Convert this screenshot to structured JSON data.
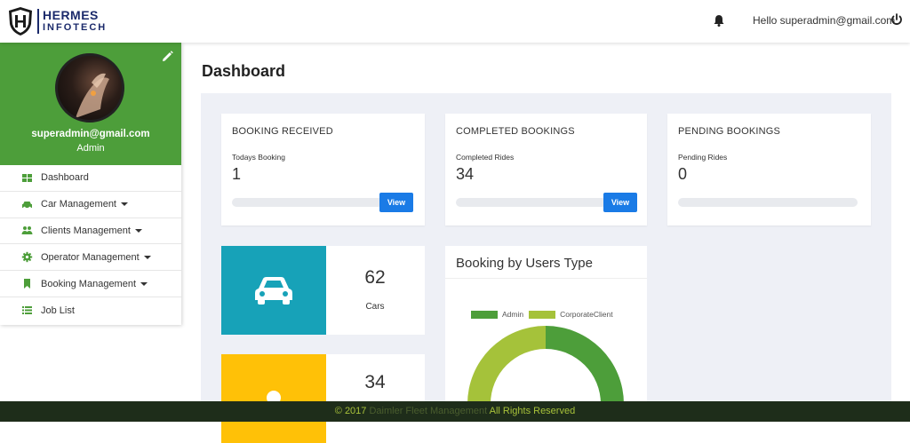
{
  "brand": {
    "line1": "HERMES",
    "line2": "INFOTECH",
    "color": "#1b2a6b"
  },
  "header": {
    "greeting": "Hello superadmin@gmail.com",
    "bell_icon": "bell-icon",
    "logout_icon": "power-icon"
  },
  "profile": {
    "email": "superadmin@gmail.com",
    "role": "Admin",
    "bg_color": "#4d9e3a"
  },
  "sidebar": {
    "items": [
      {
        "label": "Dashboard",
        "icon": "dashboard-icon",
        "has_caret": false
      },
      {
        "label": "Car Management",
        "icon": "car-icon",
        "has_caret": true
      },
      {
        "label": "Clients Management",
        "icon": "users-icon",
        "has_caret": true
      },
      {
        "label": "Operator Management",
        "icon": "gear-icon",
        "has_caret": true
      },
      {
        "label": "Booking Management",
        "icon": "bookmark-icon",
        "has_caret": true
      },
      {
        "label": "Job List",
        "icon": "list-icon",
        "has_caret": false
      }
    ]
  },
  "page": {
    "title": "Dashboard"
  },
  "cards": [
    {
      "heading": "BOOKING RECEIVED",
      "sub": "Todays Booking",
      "value": "1",
      "button": "View"
    },
    {
      "heading": "COMPLETED BOOKINGS",
      "sub": "Completed Rides",
      "value": "34",
      "button": "View"
    },
    {
      "heading": "PENDING BOOKINGS",
      "sub": "Pending Rides",
      "value": "0"
    }
  ],
  "stats": [
    {
      "value": "62",
      "label": "Cars",
      "color": "#17a2b8",
      "icon": "car-icon"
    },
    {
      "value": "34",
      "label": "",
      "color": "#ffc107",
      "icon": "user-icon"
    }
  ],
  "booking_chart": {
    "title": "Booking by Users Type",
    "legend": [
      {
        "name": "Admin",
        "color": "#4d9e3a"
      },
      {
        "name": "CorporateClient",
        "color": "#a5c23a"
      }
    ]
  },
  "footer": {
    "copyright": "© 2017",
    "company": "Daimler Fleet Management",
    "rights": "All Rights Reserved"
  }
}
